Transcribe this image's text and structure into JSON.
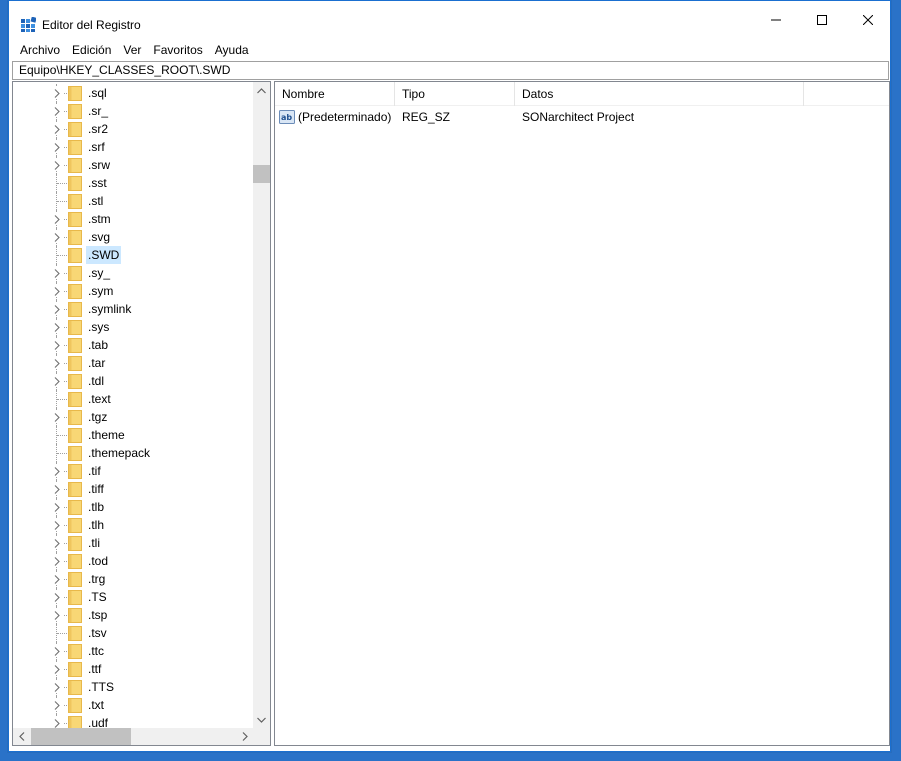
{
  "window": {
    "title": "Editor del Registro"
  },
  "menu": [
    "Archivo",
    "Edición",
    "Ver",
    "Favoritos",
    "Ayuda"
  ],
  "address": "Equipo\\HKEY_CLASSES_ROOT\\.SWD",
  "tree": {
    "selected": ".SWD",
    "items": [
      {
        "label": ".sql",
        "expandable": true
      },
      {
        "label": ".sr_",
        "expandable": true
      },
      {
        "label": ".sr2",
        "expandable": true
      },
      {
        "label": ".srf",
        "expandable": true
      },
      {
        "label": ".srw",
        "expandable": true
      },
      {
        "label": ".sst",
        "expandable": false
      },
      {
        "label": ".stl",
        "expandable": false
      },
      {
        "label": ".stm",
        "expandable": true
      },
      {
        "label": ".svg",
        "expandable": true
      },
      {
        "label": ".SWD",
        "expandable": false
      },
      {
        "label": ".sy_",
        "expandable": true
      },
      {
        "label": ".sym",
        "expandable": true
      },
      {
        "label": ".symlink",
        "expandable": true
      },
      {
        "label": ".sys",
        "expandable": true
      },
      {
        "label": ".tab",
        "expandable": true
      },
      {
        "label": ".tar",
        "expandable": true
      },
      {
        "label": ".tdl",
        "expandable": true
      },
      {
        "label": ".text",
        "expandable": false
      },
      {
        "label": ".tgz",
        "expandable": true
      },
      {
        "label": ".theme",
        "expandable": false
      },
      {
        "label": ".themepack",
        "expandable": false
      },
      {
        "label": ".tif",
        "expandable": true
      },
      {
        "label": ".tiff",
        "expandable": true
      },
      {
        "label": ".tlb",
        "expandable": true
      },
      {
        "label": ".tlh",
        "expandable": true
      },
      {
        "label": ".tli",
        "expandable": true
      },
      {
        "label": ".tod",
        "expandable": true
      },
      {
        "label": ".trg",
        "expandable": true
      },
      {
        "label": ".TS",
        "expandable": true
      },
      {
        "label": ".tsp",
        "expandable": true
      },
      {
        "label": ".tsv",
        "expandable": false
      },
      {
        "label": ".ttc",
        "expandable": true
      },
      {
        "label": ".ttf",
        "expandable": true
      },
      {
        "label": ".TTS",
        "expandable": true
      },
      {
        "label": ".txt",
        "expandable": true
      },
      {
        "label": ".udf",
        "expandable": true
      }
    ]
  },
  "values": {
    "columns": [
      "Nombre",
      "Tipo",
      "Datos"
    ],
    "rows": [
      {
        "name": "(Predeterminado)",
        "type": "REG_SZ",
        "data": "SONarchitect Project",
        "icon": "string-value-icon"
      }
    ]
  },
  "colors": {
    "selection": "#cce8ff",
    "folder": "#f8d775",
    "folder_dark": "#e8b84a",
    "accent": "#1a6fd0"
  }
}
